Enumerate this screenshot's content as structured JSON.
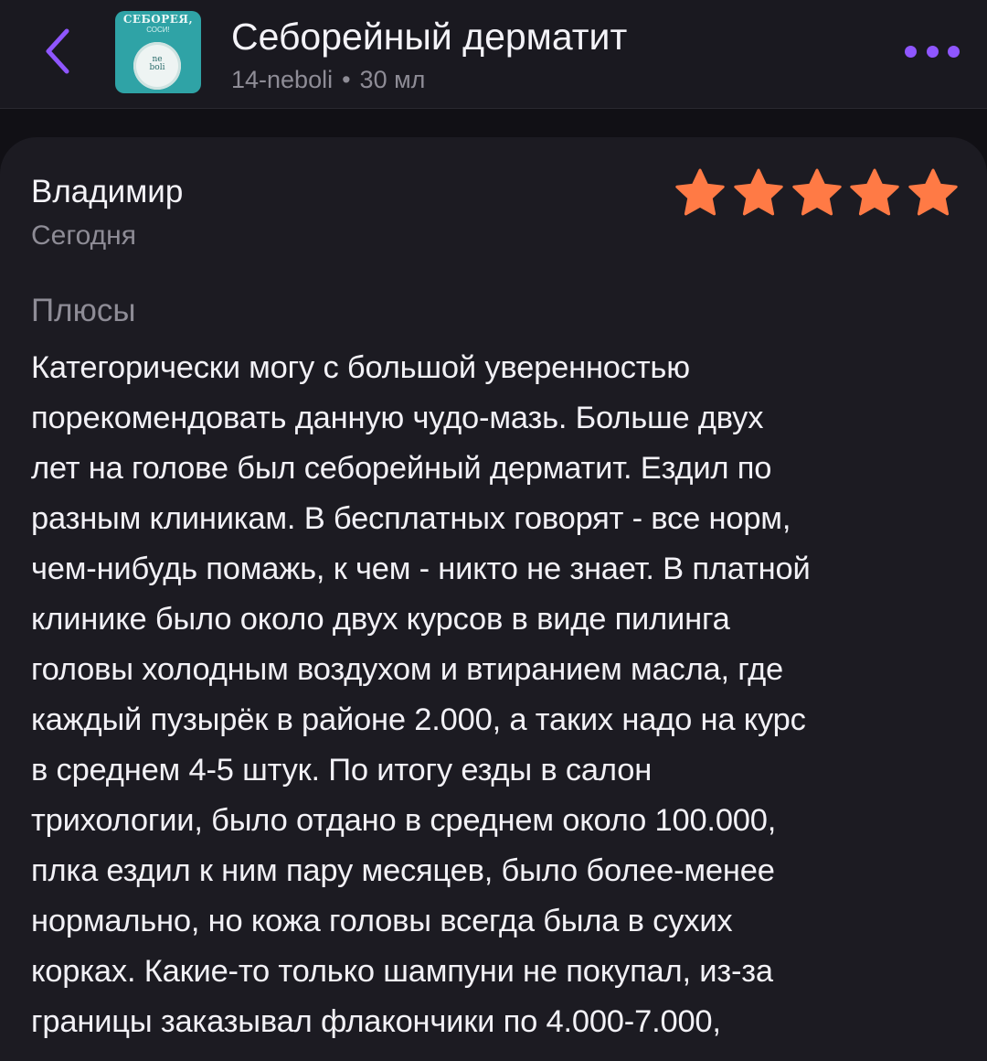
{
  "header": {
    "title": "Себорейный дерматит",
    "seller": "14-neboli",
    "separator": "•",
    "volume": "30 мл",
    "thumbnail": {
      "brand_text": "СЕБОРЕЯ,",
      "brand_sub": "СОСИ!",
      "jar_label_top": "ne",
      "jar_label_bottom": "boli"
    },
    "back_icon": "chevron-left-icon",
    "more_icon": "more-dots-icon",
    "accent_color": "#8f56ff"
  },
  "review": {
    "author": "Владимир",
    "date": "Сегодня",
    "rating": 5,
    "rating_max": 5,
    "star_color": "#ff7a45",
    "section_label": "Плюсы",
    "text_lines": [
      "Категорически могу с большой уверенностью",
      "порекомендовать данную чудо-мазь. Больше двух",
      "лет на голове был себорейный дерматит. Ездил по",
      "разным клиникам. В бесплатных говорят - все норм,",
      "чем-нибудь помажь, к чем - никто не знает. В платной",
      "клинике было около двух курсов в виде пилинга",
      "головы холодным воздухом и втиранием масла, где",
      "каждый пузырёк в районе 2.000, а таких надо на курс",
      "в среднем 4-5 штук. По итогу езды в салон",
      "трихологии, было отдано в среднем около 100.000,",
      "плка ездил к ним пару месяцев, было более-менее",
      "нормально, но кожа головы всегда была в сухих",
      "корках. Какие-то только шампуни не покупал, из-за",
      "границы заказывал флакончики по 4.000-7.000,"
    ]
  }
}
